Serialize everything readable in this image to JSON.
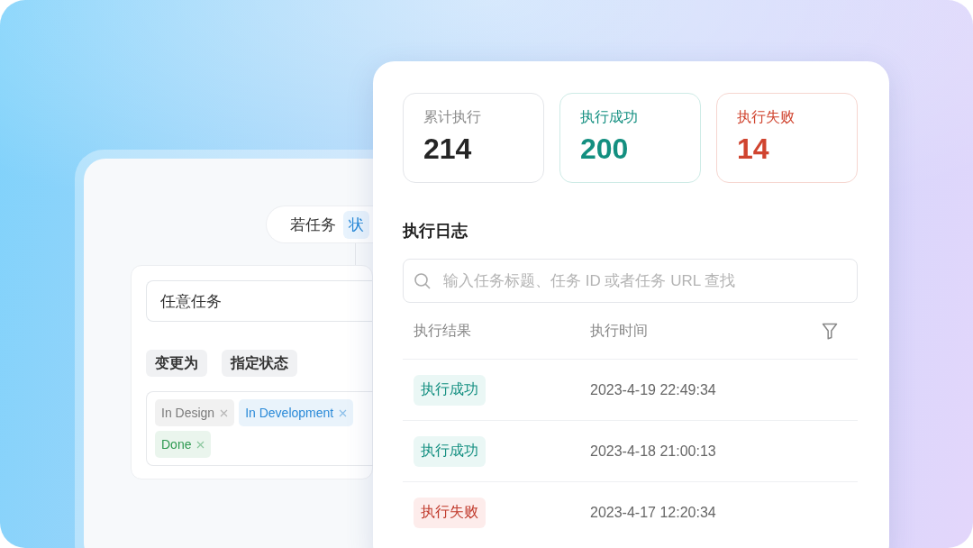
{
  "condition": {
    "prefix": "若任务",
    "field": "状"
  },
  "rule": {
    "task_field": {
      "value": "任意任务"
    },
    "action": "变更为",
    "target": "指定状态",
    "statuses": [
      {
        "label": "In Design",
        "color": "#7a7a7a"
      },
      {
        "label": "In Development",
        "color": "#2b8ad8"
      },
      {
        "label": "Done",
        "color": "#2f9a52"
      }
    ]
  },
  "stats": [
    {
      "label": "累计执行",
      "value": "214",
      "kind": "total"
    },
    {
      "label": "执行成功",
      "value": "200",
      "kind": "success"
    },
    {
      "label": "执行失败",
      "value": "14",
      "kind": "failure"
    }
  ],
  "log": {
    "title": "执行日志",
    "search": {
      "placeholder": "输入任务标题、任务 ID 或者任务 URL 查找"
    },
    "columns": [
      "执行结果",
      "执行时间"
    ],
    "rows": [
      {
        "result": "执行成功",
        "kind": "success",
        "time": "2023-4-19 22:49:34"
      },
      {
        "result": "执行成功",
        "kind": "success",
        "time": "2023-4-18 21:00:13"
      },
      {
        "result": "执行失败",
        "kind": "failure",
        "time": "2023-4-17 12:20:34"
      }
    ]
  }
}
